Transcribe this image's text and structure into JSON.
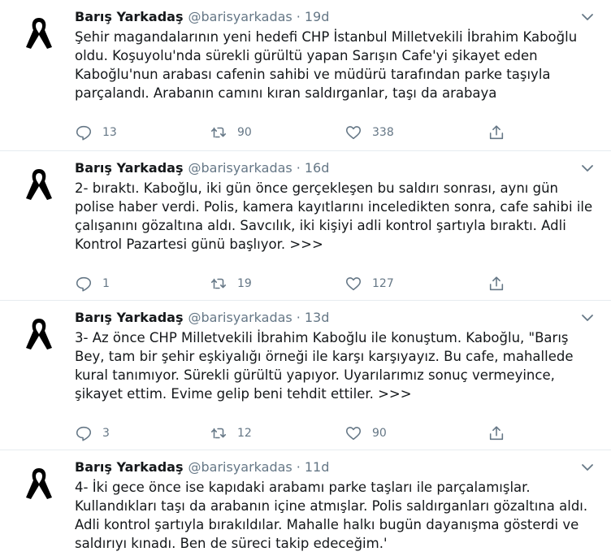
{
  "tweets": [
    {
      "name": "Barış Yarkadaş",
      "handle": "@barisyarkadas",
      "dot": "·",
      "time": "19d",
      "text": "Şehir magandalarının yeni hedefi CHP İstanbul Milletvekili İbrahim Kaboğlu oldu. Koşuyolu'nda sürekli gürültü yapan Sarışın Cafe'yi şikayet eden Kaboğlu'nun arabası cafenin sahibi ve müdürü tarafından parke taşıyla parçalandı. Arabanın camını kıran saldırganlar, taşı da arabaya",
      "replies": "13",
      "retweets": "90",
      "likes": "338"
    },
    {
      "name": "Barış Yarkadaş",
      "handle": "@barisyarkadas",
      "dot": "·",
      "time": "16d",
      "text": "2- bıraktı. Kaboğlu, iki gün önce gerçekleşen bu saldırı sonrası, aynı gün polise haber verdi. Polis, kamera kayıtlarını inceledikten sonra, cafe sahibi ile çalışanını gözaltına aldı. Savcılık, iki kişiyi adli kontrol şartıyla bıraktı. Adli Kontrol Pazartesi günü başlıyor. >>>",
      "replies": "1",
      "retweets": "19",
      "likes": "127"
    },
    {
      "name": "Barış Yarkadaş",
      "handle": "@barisyarkadas",
      "dot": "·",
      "time": "13d",
      "text": "3- Az önce CHP Milletvekili İbrahim Kaboğlu ile konuştum. Kaboğlu, \"Barış Bey, tam bir şehir eşkiyalığı örneği ile karşı karşıyayız. Bu cafe, mahallede kural tanımıyor. Sürekli gürültü yapıyor. Uyarılarımız sonuç vermeyince, şikayet ettim. Evime gelip beni tehdit ettiler. >>>",
      "replies": "3",
      "retweets": "12",
      "likes": "90"
    },
    {
      "name": "Barış Yarkadaş",
      "handle": "@barisyarkadas",
      "dot": "·",
      "time": "11d",
      "text": "4- İki gece önce ise kapıdaki arabamı parke taşları ile parçalamışlar. Kullandıkları taşı da arabanın içine atmışlar. Polis saldırganları gözaltına aldı. Adli kontrol şartıyla bırakıldılar. Mahalle halkı bugün dayanışma gösterdi ve saldırıyı kınadı. Ben de süreci takip edeceğim.'",
      "replies": "",
      "retweets": "",
      "likes": ""
    }
  ],
  "icons": {
    "avatar": "black-ribbon-icon",
    "menu": "chevron-down-icon",
    "reply": "reply-icon",
    "retweet": "retweet-icon",
    "like": "heart-icon",
    "share": "share-icon"
  },
  "colors": {
    "text": "#14171a",
    "secondary": "#657786",
    "divider": "#e6ecf0",
    "ribbon": "#000000"
  }
}
